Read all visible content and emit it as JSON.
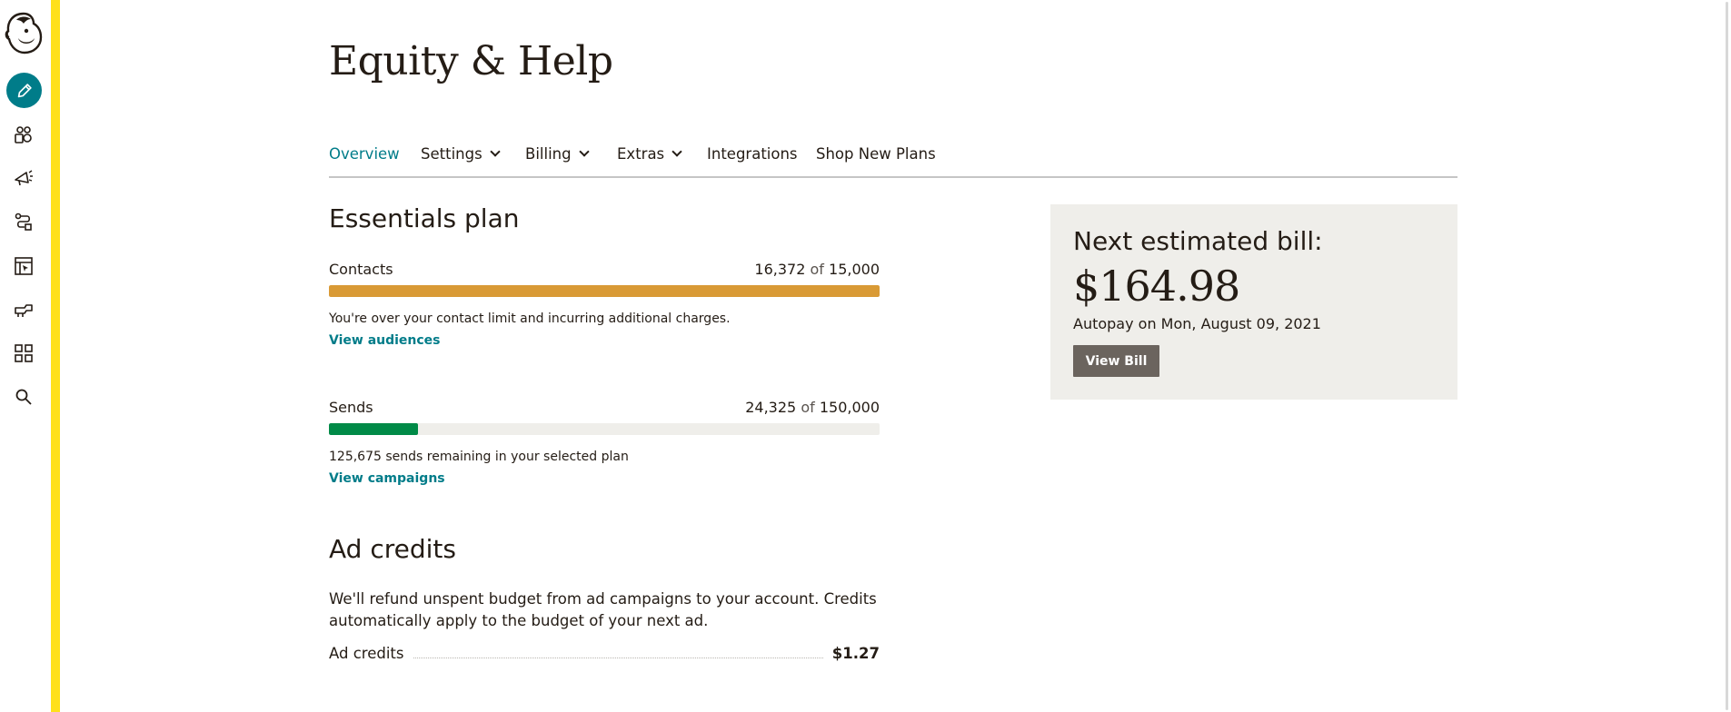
{
  "header": {
    "title": "Equity & Help"
  },
  "tabs": [
    {
      "label": "Overview",
      "active": true,
      "dropdown": false
    },
    {
      "label": "Settings",
      "active": false,
      "dropdown": true
    },
    {
      "label": "Billing",
      "active": false,
      "dropdown": true
    },
    {
      "label": "Extras",
      "active": false,
      "dropdown": true
    },
    {
      "label": "Integrations",
      "active": false,
      "dropdown": false
    },
    {
      "label": "Shop New Plans",
      "active": false,
      "dropdown": false
    }
  ],
  "plan": {
    "title": "Essentials plan",
    "contacts": {
      "label": "Contacts",
      "used": "16,372",
      "of": "of",
      "limit": "15,000",
      "fill_fraction": 1.0,
      "fill_color": "#d99a35",
      "note": "You're over your contact limit and incurring additional charges.",
      "link": "View audiences"
    },
    "sends": {
      "label": "Sends",
      "used": "24,325",
      "of": "of",
      "limit": "150,000",
      "fill_fraction": 0.162,
      "fill_color": "#008a47",
      "note": "125,675 sends remaining in your selected plan",
      "link": "View campaigns"
    }
  },
  "ad_credits": {
    "title": "Ad credits",
    "description": "We'll refund unspent budget from ad campaigns to your account. Credits automatically apply to the budget of your next ad.",
    "row_label": "Ad credits",
    "row_value": "$1.27"
  },
  "bill": {
    "title": "Next estimated bill:",
    "amount": "$164.98",
    "autopay": "Autopay on Mon, August 09, 2021",
    "button": "View Bill"
  },
  "sidebar": {
    "icons": [
      "freddie-logo-icon",
      "create-pencil-icon",
      "audience-icon",
      "campaigns-megaphone-icon",
      "automations-icon",
      "website-icon",
      "content-studio-icon",
      "integrations-grid-icon",
      "search-icon"
    ]
  },
  "colors": {
    "accent": "#007c89",
    "brand_yellow": "#ffe01b",
    "over_limit": "#d99a35",
    "sends_green": "#008a47",
    "card_bg": "#efeeea"
  }
}
